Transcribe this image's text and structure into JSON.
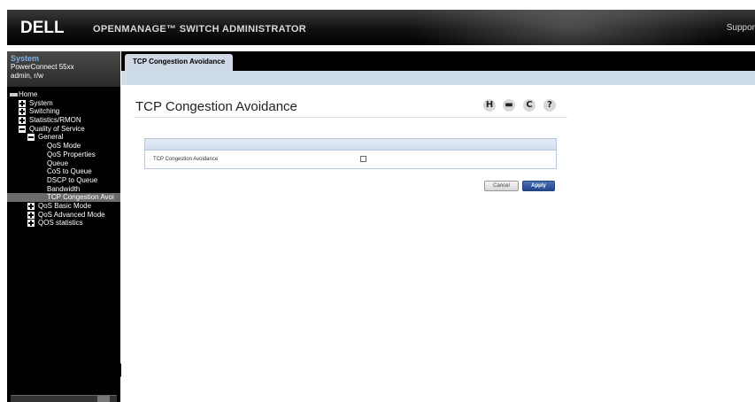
{
  "header": {
    "logo": "DELL",
    "app_title": "OPENMANAGE™ SWITCH ADMINISTRATOR",
    "support_label": "Suppor"
  },
  "sidebar": {
    "system": {
      "title": "System",
      "model": "PowerConnect 55xx",
      "user": "admin, r/w"
    },
    "tree": [
      {
        "label": "Home",
        "expander": "none",
        "selected": false
      },
      {
        "label": "System",
        "expander": "plus",
        "selected": false
      },
      {
        "label": "Switching",
        "expander": "plus",
        "selected": false
      },
      {
        "label": "Statistics/RMON",
        "expander": "plus",
        "selected": false
      },
      {
        "label": "Quality of Service",
        "expander": "minus",
        "selected": false
      },
      {
        "label": "General",
        "expander": "minus",
        "selected": false
      },
      {
        "label": "QoS Mode",
        "expander": "none",
        "selected": false
      },
      {
        "label": "QoS Properties",
        "expander": "none",
        "selected": false
      },
      {
        "label": "Queue",
        "expander": "none",
        "selected": false
      },
      {
        "label": "CoS to Queue",
        "expander": "none",
        "selected": false
      },
      {
        "label": "DSCP to Queue",
        "expander": "none",
        "selected": false
      },
      {
        "label": "Bandwidth",
        "expander": "none",
        "selected": false
      },
      {
        "label": "TCP Congestion Avoi",
        "expander": "none",
        "selected": true
      },
      {
        "label": "QoS Basic Mode",
        "expander": "plus",
        "selected": false
      },
      {
        "label": "QoS Advanced Mode",
        "expander": "plus",
        "selected": false
      },
      {
        "label": "QOS statistics",
        "expander": "plus",
        "selected": false
      }
    ]
  },
  "main": {
    "tab_label": "TCP Congestion Avoidance",
    "page_title": "TCP Congestion Avoidance",
    "toolbar_icons": [
      {
        "name": "save-icon",
        "glyph": "H"
      },
      {
        "name": "print-icon",
        "glyph": "▬"
      },
      {
        "name": "refresh-icon",
        "glyph": "C"
      },
      {
        "name": "help-icon",
        "glyph": "?"
      }
    ],
    "form": {
      "field_label": "TCP Congestion Avoidance",
      "checked": false
    },
    "buttons": {
      "cancel": "Cancel",
      "apply": "Apply"
    }
  },
  "colors": {
    "header_bg": "#000000",
    "accent_blue": "#23468e",
    "subbar": "#cfdde8",
    "selected_tree": "#6b6b6b"
  }
}
